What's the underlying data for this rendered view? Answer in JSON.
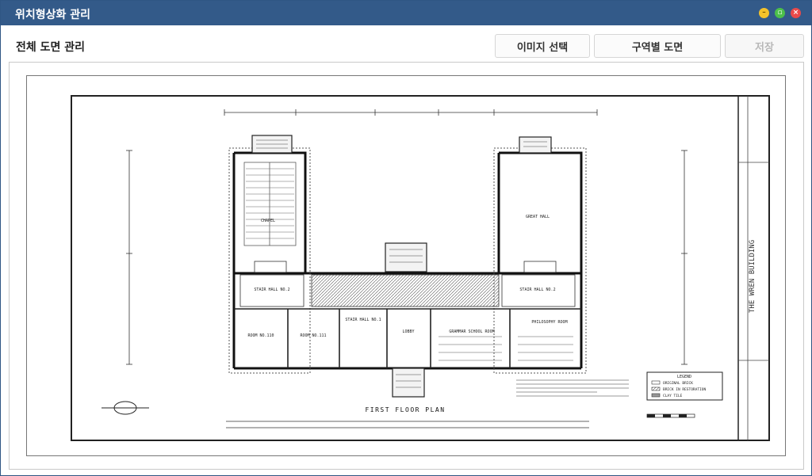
{
  "window": {
    "title": "위치형상화 관리",
    "controls": [
      "minimize",
      "maximize",
      "close"
    ]
  },
  "header": {
    "section_title": "전체 도면 관리"
  },
  "toolbar": {
    "select_image_label": "이미지 선택",
    "zone_plan_label": "구역별 도면",
    "save_label": "저장",
    "save_enabled": false
  },
  "floor_plan": {
    "title": "FIRST FLOOR PLAN",
    "building_name": "THE WREN BUILDING",
    "rooms": [
      "STAIR HALL NO.2",
      "STAIR HALL NO.1",
      "LOBBY",
      "GRAMMAR SCHOOL ROOM",
      "PHILOSOPHY ROOM",
      "ROOM NO.110",
      "ROOM NO.111",
      "GREAT HALL",
      "CHAPEL"
    ],
    "legend": {
      "title": "LEGEND",
      "items": [
        "ORIGINAL BRICK",
        "BRICK IN RESTORATION",
        "CLAY TILE"
      ]
    }
  },
  "colors": {
    "titlebar": "#335a89",
    "minimize": "#f4c22b",
    "maximize": "#4cc04a",
    "close": "#ea4a4a"
  }
}
